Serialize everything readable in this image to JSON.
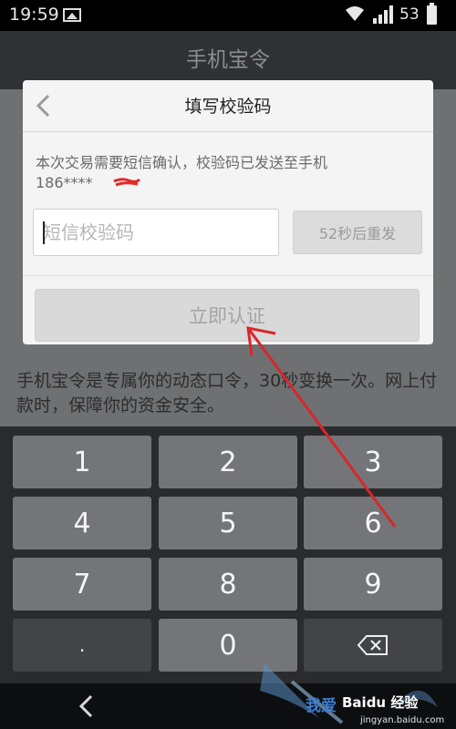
{
  "status_bar": {
    "time": "19:59",
    "battery": "53"
  },
  "app": {
    "title": "手机宝令"
  },
  "background_text": "手机宝令是专属你的动态口令，30秒变换一次。网上付款时，保障你的资金安全。",
  "dialog": {
    "title": "填写校验码",
    "message_line1": "本次交易需要短信确认，校验码已发送至手机",
    "phone": "186****",
    "input_placeholder": "短信校验码",
    "resend_label": "52秒后重发",
    "verify_label": "立即认证"
  },
  "keypad": {
    "rows": [
      [
        "1",
        "2",
        "3"
      ],
      [
        "4",
        "5",
        "6"
      ],
      [
        "7",
        "8",
        "9"
      ],
      [
        ".",
        "0",
        ""
      ]
    ]
  },
  "watermark": {
    "brand": "Baidu 经验",
    "url": "jingyan.baidu.com",
    "tagline": "我爱"
  },
  "colors": {
    "annotation_arrow": "#d9262c"
  }
}
